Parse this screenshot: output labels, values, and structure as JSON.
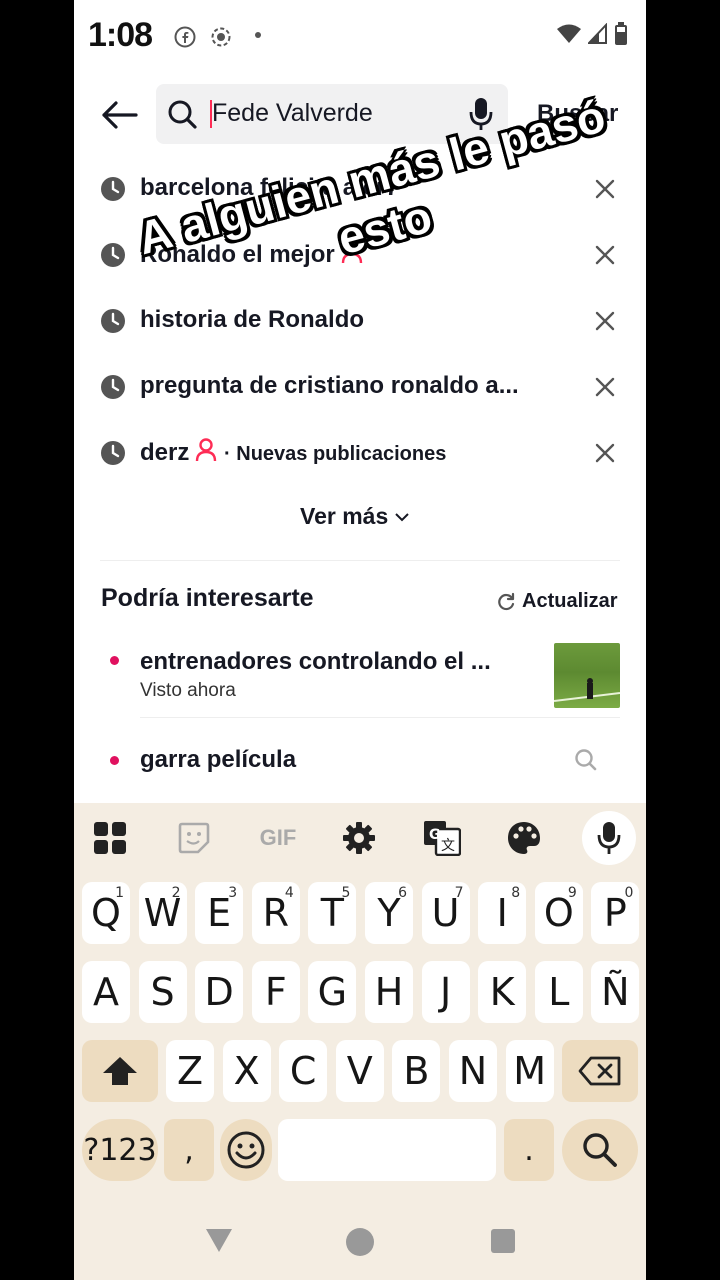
{
  "status_bar": {
    "time": "1:08"
  },
  "search": {
    "query": "Fede Valverde",
    "submit_label": "Buscar"
  },
  "history": [
    {
      "label": "barcelona felicita a cr7"
    },
    {
      "label": "Ronaldo el mejor",
      "has_user_icon": true
    },
    {
      "label": "historia de Ronaldo"
    },
    {
      "label": "pregunta de cristiano ronaldo a..."
    },
    {
      "label": "derz",
      "has_user_icon": true,
      "note": "· Nuevas publicaciones"
    }
  ],
  "show_more": "Ver más",
  "suggestions": {
    "title": "Podría interesarte",
    "refresh_label": "Actualizar",
    "items": [
      {
        "title": "entrenadores controlando el ...",
        "subtitle": "Visto ahora"
      },
      {
        "title": "garra película"
      }
    ]
  },
  "overlay_caption": "A alguien más le pasó esto",
  "keyboard": {
    "toolbar": [
      "apps-icon",
      "sticker-icon",
      "GIF",
      "settings-icon",
      "translate-icon",
      "palette-icon",
      "mic-icon"
    ],
    "row1": [
      {
        "k": "Q",
        "h": "1"
      },
      {
        "k": "W",
        "h": "2"
      },
      {
        "k": "E",
        "h": "3"
      },
      {
        "k": "R",
        "h": "4"
      },
      {
        "k": "T",
        "h": "5"
      },
      {
        "k": "Y",
        "h": "6"
      },
      {
        "k": "U",
        "h": "7"
      },
      {
        "k": "I",
        "h": "8"
      },
      {
        "k": "O",
        "h": "9"
      },
      {
        "k": "P",
        "h": "0"
      }
    ],
    "row2": [
      "A",
      "S",
      "D",
      "F",
      "G",
      "H",
      "J",
      "K",
      "L",
      "Ñ"
    ],
    "row3": [
      "Z",
      "X",
      "C",
      "V",
      "B",
      "N",
      "M"
    ],
    "symbols_label": "?123",
    "comma": ",",
    "period": "."
  },
  "colors": {
    "accent": "#fe2c55",
    "dot": "#e0115f",
    "keyboard_bg": "#f4ede2",
    "func_key": "#eddcc0"
  }
}
